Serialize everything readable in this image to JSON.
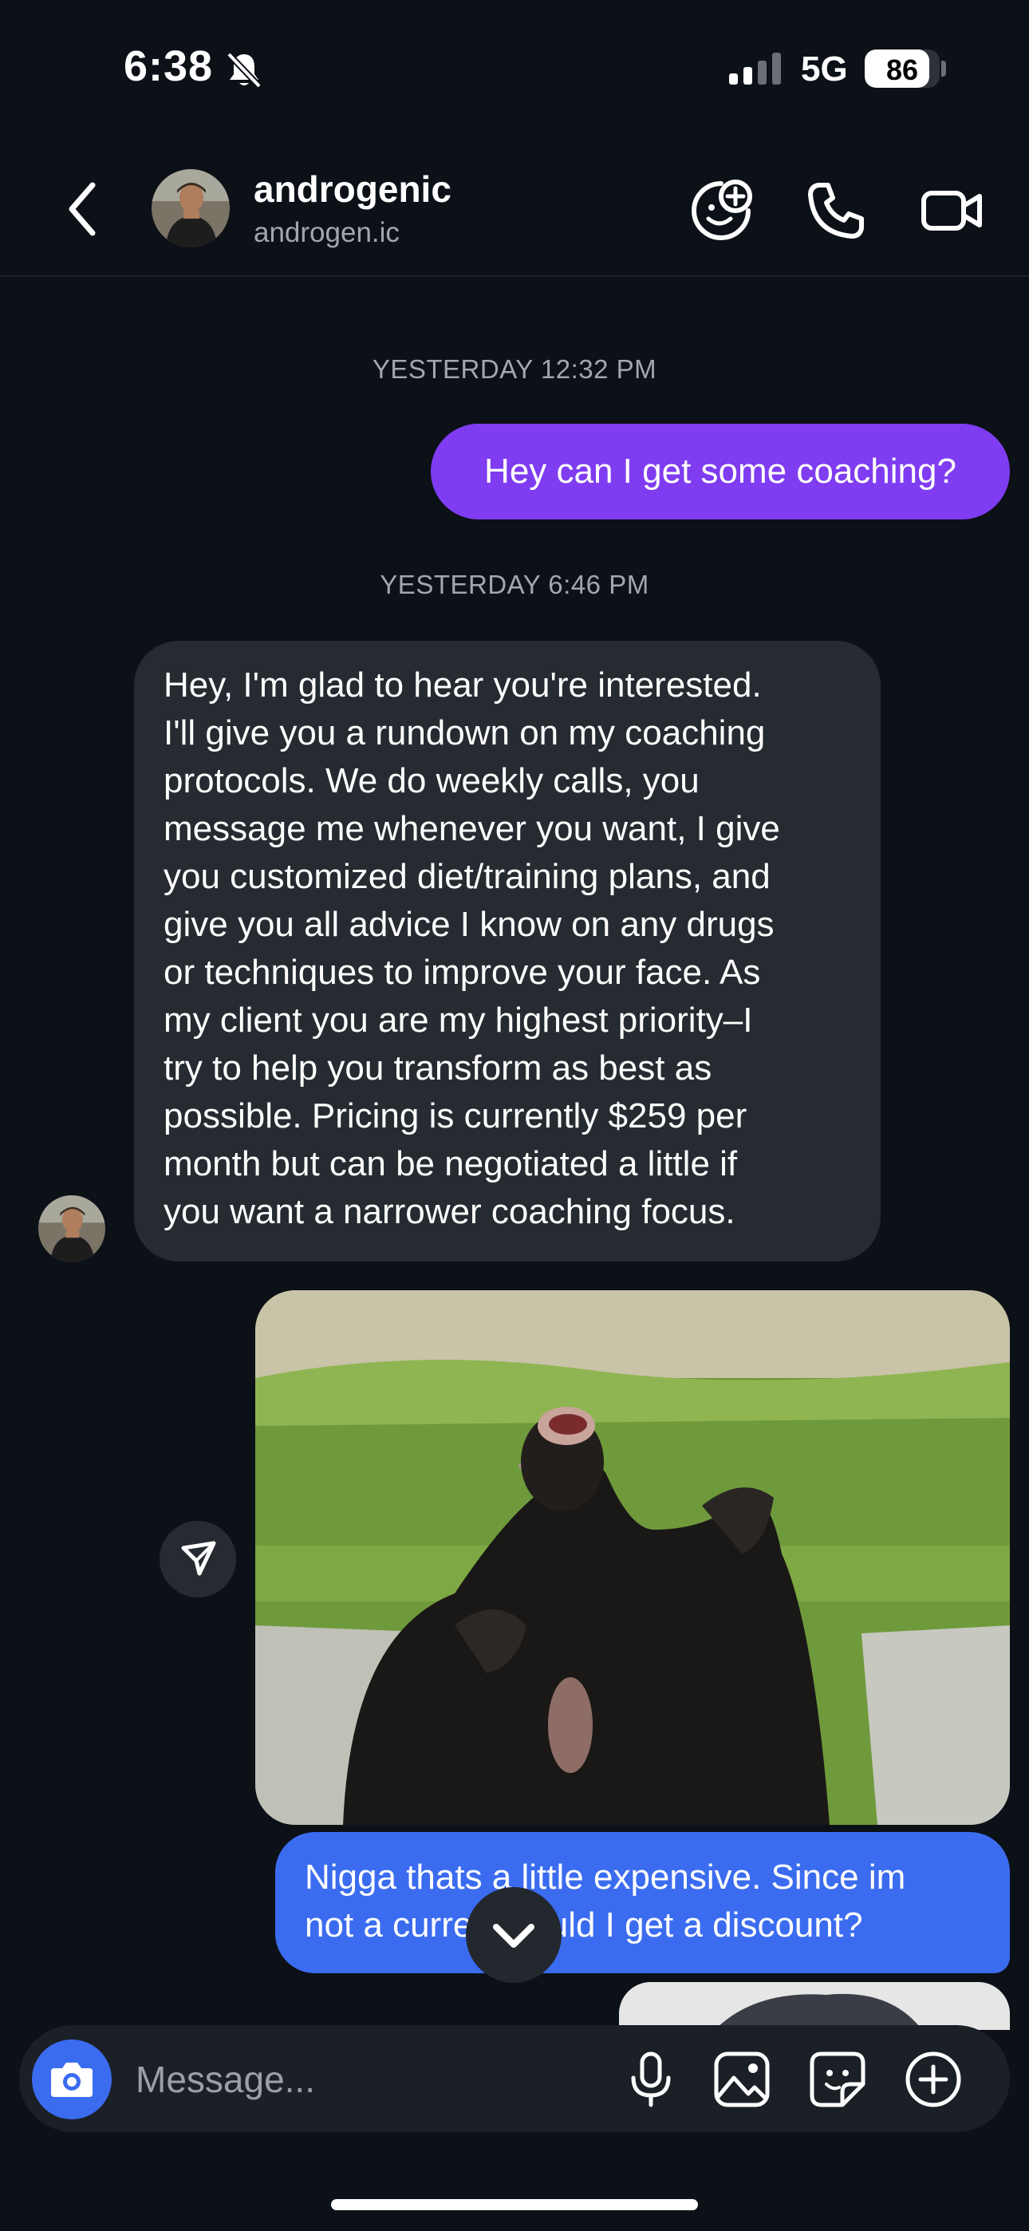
{
  "status_bar": {
    "time": "6:38",
    "network": "5G",
    "battery": "86",
    "battery_level": 0.86,
    "mute_icon": "bell-slash-icon"
  },
  "header": {
    "name": "androgenic",
    "handle": "androgen.ic",
    "icons": [
      "back-chevron-icon",
      "avatar",
      "sticker-add-icon",
      "phone-icon",
      "video-camera-icon"
    ]
  },
  "thread": {
    "timestamp_1": "YESTERDAY 12:32 PM",
    "msg_1": "Hey can I get some coaching?",
    "timestamp_2": "YESTERDAY 6:46 PM",
    "msg_2": "Hey, I'm glad to hear you're interested.\nI'll give you a rundown on my coaching\nprotocols. We do weekly calls, you\nmessage me whenever you want, I give\nyou customized diet/training plans, and\ngive you all advice I know on any drugs\nor techniques to improve your face. As\nmy client you are my highest priority–I\ntry to help you transform as best as\npossible. Pricing is currently $259 per\nmonth but can be negotiated a little if\nyou want a narrower coaching focus.",
    "msg_3": "Nigga thats a little expensive. Since im\nnot a current could I get a discount?"
  },
  "composer": {
    "placeholder": "Message...",
    "icons": [
      "camera-icon",
      "microphone-icon",
      "gallery-icon",
      "sticker-icon",
      "plus-icon"
    ]
  },
  "colors": {
    "background": "#0c1017",
    "sent_purple": "#7f3cf0",
    "sent_blue": "#3b6cf0",
    "received_grey": "#262a31"
  }
}
